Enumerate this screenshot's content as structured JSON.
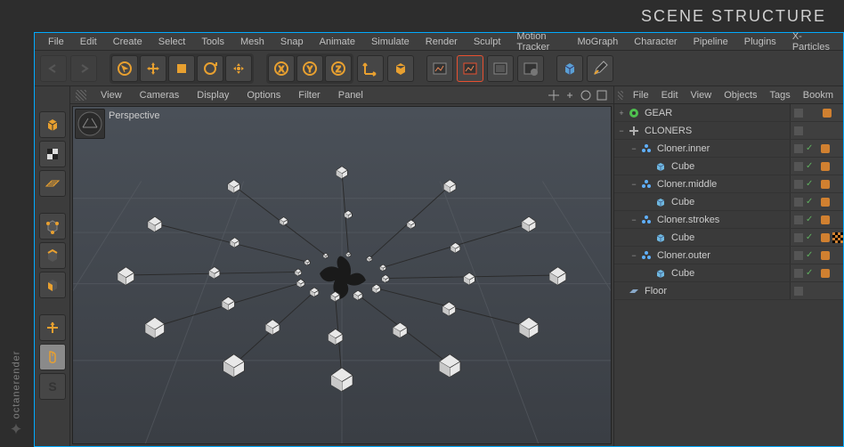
{
  "header_title": "SCENE STRUCTURE",
  "branding": "octanerender",
  "menubar": [
    "File",
    "Edit",
    "Create",
    "Select",
    "Tools",
    "Mesh",
    "Snap",
    "Animate",
    "Simulate",
    "Render",
    "Sculpt",
    "Motion Tracker",
    "MoGraph",
    "Character",
    "Pipeline",
    "Plugins",
    "X-Particles"
  ],
  "viewport_menu": [
    "View",
    "Cameras",
    "Display",
    "Options",
    "Filter",
    "Panel"
  ],
  "viewport_label": "Perspective",
  "right_menu": [
    "File",
    "Edit",
    "View",
    "Objects",
    "Tags",
    "Bookm"
  ],
  "tree": [
    {
      "indent": 0,
      "exp": "+",
      "icon": "gear",
      "color": "#4fc04f",
      "label": "GEAR",
      "flags": true,
      "tag": "dot"
    },
    {
      "indent": 0,
      "exp": "−",
      "icon": "null",
      "color": "#b0b0b0",
      "label": "CLONERS",
      "flags": true
    },
    {
      "indent": 1,
      "exp": "−",
      "icon": "cloner",
      "color": "#5fb0ff",
      "label": "Cloner.inner",
      "flags": true,
      "check": true,
      "tag": "dot"
    },
    {
      "indent": 2,
      "exp": "",
      "icon": "cube",
      "color": "#6fb8e0",
      "label": "Cube",
      "flags": true,
      "check": true,
      "tag": "dot"
    },
    {
      "indent": 1,
      "exp": "−",
      "icon": "cloner",
      "color": "#5fb0ff",
      "label": "Cloner.middle",
      "flags": true,
      "check": true,
      "tag": "dot"
    },
    {
      "indent": 2,
      "exp": "",
      "icon": "cube",
      "color": "#6fb8e0",
      "label": "Cube",
      "flags": true,
      "check": true,
      "tag": "dot"
    },
    {
      "indent": 1,
      "exp": "−",
      "icon": "cloner",
      "color": "#5fb0ff",
      "label": "Cloner.strokes",
      "flags": true,
      "check": true,
      "tag": "dot"
    },
    {
      "indent": 2,
      "exp": "",
      "icon": "cube",
      "color": "#6fb8e0",
      "label": "Cube",
      "flags": true,
      "check": true,
      "tag": "dot",
      "tag2": "checker"
    },
    {
      "indent": 1,
      "exp": "−",
      "icon": "cloner",
      "color": "#5fb0ff",
      "label": "Cloner.outer",
      "flags": true,
      "check": true,
      "tag": "dot"
    },
    {
      "indent": 2,
      "exp": "",
      "icon": "cube",
      "color": "#6fb8e0",
      "label": "Cube",
      "flags": true,
      "check": true,
      "tag": "dot"
    },
    {
      "indent": 0,
      "exp": "",
      "icon": "floor",
      "color": "#88a8c8",
      "label": "Floor",
      "flags": true
    }
  ]
}
